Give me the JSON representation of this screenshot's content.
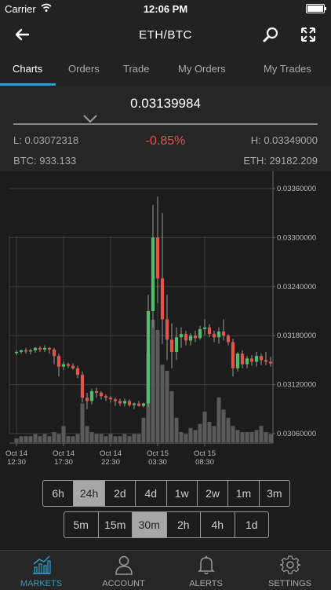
{
  "status": {
    "carrier": "Carrier",
    "time": "12:06 PM"
  },
  "nav": {
    "title": "ETH/BTC"
  },
  "tabs": [
    "Charts",
    "Orders",
    "Trade",
    "My Orders",
    "My Trades"
  ],
  "ticker": {
    "price": "0.03139984",
    "low": "L: 0.03072318",
    "change": "-0.85%",
    "high": "H: 0.03349000",
    "btc_volume": "BTC: 933.133",
    "eth_volume": "ETH: 29182.209"
  },
  "colors": {
    "up": "#4bbf6b",
    "down": "#e5534b",
    "accent": "#2a9fc9"
  },
  "chart_data": {
    "type": "candlestick",
    "y_ticks": [
      "0.03360000",
      "0.03300000",
      "0.03240000",
      "0.03180000",
      "0.03120000",
      "0.03060000"
    ],
    "ylim": [
      0.0306,
      0.0336
    ],
    "x_ticks": [
      {
        "label1": "Oct 14",
        "label2": "12:30",
        "i": 0
      },
      {
        "label1": "Oct 14",
        "label2": "17:30",
        "i": 10
      },
      {
        "label1": "Oct 14",
        "label2": "22:30",
        "i": 20
      },
      {
        "label1": "Oct 15",
        "label2": "03:30",
        "i": 30
      },
      {
        "label1": "Oct 15",
        "label2": "08:30",
        "i": 40
      }
    ],
    "candles": [
      [
        0.0316,
        0.03162,
        0.03156,
        0.0316,
        0.02
      ],
      [
        0.0316,
        0.03163,
        0.03158,
        0.03162,
        0.03
      ],
      [
        0.03162,
        0.03165,
        0.03158,
        0.03161,
        0.03
      ],
      [
        0.03161,
        0.03164,
        0.03157,
        0.03162,
        0.03
      ],
      [
        0.03162,
        0.03166,
        0.03159,
        0.03165,
        0.04
      ],
      [
        0.03165,
        0.03167,
        0.0316,
        0.03163,
        0.03
      ],
      [
        0.03163,
        0.03168,
        0.0316,
        0.03165,
        0.04
      ],
      [
        0.03165,
        0.03166,
        0.03158,
        0.03163,
        0.03
      ],
      [
        0.03163,
        0.03165,
        0.03145,
        0.03155,
        0.05
      ],
      [
        0.03155,
        0.03158,
        0.0313,
        0.03142,
        0.04
      ],
      [
        0.03142,
        0.03148,
        0.03138,
        0.03145,
        0.08
      ],
      [
        0.03145,
        0.03147,
        0.0314,
        0.03143,
        0.03
      ],
      [
        0.03143,
        0.03146,
        0.03138,
        0.0314,
        0.03
      ],
      [
        0.0314,
        0.03143,
        0.03128,
        0.03132,
        0.04
      ],
      [
        0.03132,
        0.03136,
        0.03098,
        0.03104,
        0.19
      ],
      [
        0.03104,
        0.0311,
        0.0309,
        0.031,
        0.08
      ],
      [
        0.031,
        0.03115,
        0.03096,
        0.03112,
        0.05
      ],
      [
        0.03112,
        0.03116,
        0.03104,
        0.0311,
        0.04
      ],
      [
        0.0311,
        0.03112,
        0.03102,
        0.03106,
        0.04
      ],
      [
        0.03106,
        0.03108,
        0.031,
        0.03104,
        0.03
      ],
      [
        0.03104,
        0.03106,
        0.03098,
        0.03102,
        0.04
      ],
      [
        0.03102,
        0.03104,
        0.03094,
        0.031,
        0.03
      ],
      [
        0.031,
        0.03103,
        0.03094,
        0.03097,
        0.03
      ],
      [
        0.03097,
        0.03103,
        0.03093,
        0.031,
        0.04
      ],
      [
        0.031,
        0.03102,
        0.03093,
        0.03095,
        0.03
      ],
      [
        0.03095,
        0.03098,
        0.0309,
        0.03097,
        0.04
      ],
      [
        0.03097,
        0.031,
        0.03093,
        0.03094,
        0.04
      ],
      [
        0.03094,
        0.03098,
        0.03092,
        0.03097,
        0.12
      ],
      [
        0.03097,
        0.0323,
        0.03093,
        0.0321,
        0.43
      ],
      [
        0.0321,
        0.0334,
        0.0319,
        0.033,
        0.6
      ],
      [
        0.033,
        0.0335,
        0.0322,
        0.0325,
        0.55
      ],
      [
        0.0325,
        0.0333,
        0.0317,
        0.032,
        0.38
      ],
      [
        0.032,
        0.0323,
        0.0315,
        0.03175,
        0.35
      ],
      [
        0.03175,
        0.03195,
        0.0314,
        0.0316,
        0.25
      ],
      [
        0.0316,
        0.0319,
        0.0315,
        0.03178,
        0.12
      ],
      [
        0.03178,
        0.0319,
        0.03165,
        0.03182,
        0.05
      ],
      [
        0.03182,
        0.03186,
        0.03168,
        0.03174,
        0.04
      ],
      [
        0.03174,
        0.03183,
        0.03168,
        0.0318,
        0.07
      ],
      [
        0.0318,
        0.03186,
        0.03172,
        0.03177,
        0.06
      ],
      [
        0.03177,
        0.03192,
        0.03175,
        0.03188,
        0.09
      ],
      [
        0.03188,
        0.032,
        0.0318,
        0.0319,
        0.15
      ],
      [
        0.0319,
        0.03194,
        0.03178,
        0.03182,
        0.1
      ],
      [
        0.03182,
        0.03186,
        0.03172,
        0.03178,
        0.08
      ],
      [
        0.03178,
        0.0319,
        0.0317,
        0.03185,
        0.22
      ],
      [
        0.03185,
        0.032,
        0.03174,
        0.0318,
        0.16
      ],
      [
        0.0318,
        0.03182,
        0.03168,
        0.03172,
        0.12
      ],
      [
        0.03172,
        0.03176,
        0.0313,
        0.0314,
        0.08
      ],
      [
        0.0314,
        0.0316,
        0.03136,
        0.03158,
        0.06
      ],
      [
        0.03158,
        0.03162,
        0.0314,
        0.03145,
        0.05
      ],
      [
        0.03145,
        0.03155,
        0.0314,
        0.03152,
        0.05
      ],
      [
        0.03152,
        0.03156,
        0.03143,
        0.03148,
        0.05
      ],
      [
        0.03148,
        0.0316,
        0.03142,
        0.03155,
        0.06
      ],
      [
        0.03155,
        0.03158,
        0.03144,
        0.0315,
        0.08
      ],
      [
        0.0315,
        0.0316,
        0.03144,
        0.03148,
        0.05
      ],
      [
        0.03148,
        0.03154,
        0.03142,
        0.03146,
        0.04
      ]
    ]
  },
  "timeframes_row1": [
    {
      "label": "6h",
      "selected": false
    },
    {
      "label": "24h",
      "selected": true
    },
    {
      "label": "2d",
      "selected": false
    },
    {
      "label": "4d",
      "selected": false
    },
    {
      "label": "1w",
      "selected": false
    },
    {
      "label": "2w",
      "selected": false
    },
    {
      "label": "1m",
      "selected": false
    },
    {
      "label": "3m",
      "selected": false
    }
  ],
  "timeframes_row2": [
    {
      "label": "5m",
      "selected": false
    },
    {
      "label": "15m",
      "selected": false
    },
    {
      "label": "30m",
      "selected": true
    },
    {
      "label": "2h",
      "selected": false
    },
    {
      "label": "4h",
      "selected": false
    },
    {
      "label": "1d",
      "selected": false
    }
  ],
  "tabbar": [
    {
      "label": "MARKETS",
      "icon": "chart-icon",
      "active": true
    },
    {
      "label": "ACCOUNT",
      "icon": "person-icon",
      "active": false
    },
    {
      "label": "ALERTS",
      "icon": "bell-icon",
      "active": false
    },
    {
      "label": "SETTINGS",
      "icon": "gear-icon",
      "active": false
    }
  ]
}
